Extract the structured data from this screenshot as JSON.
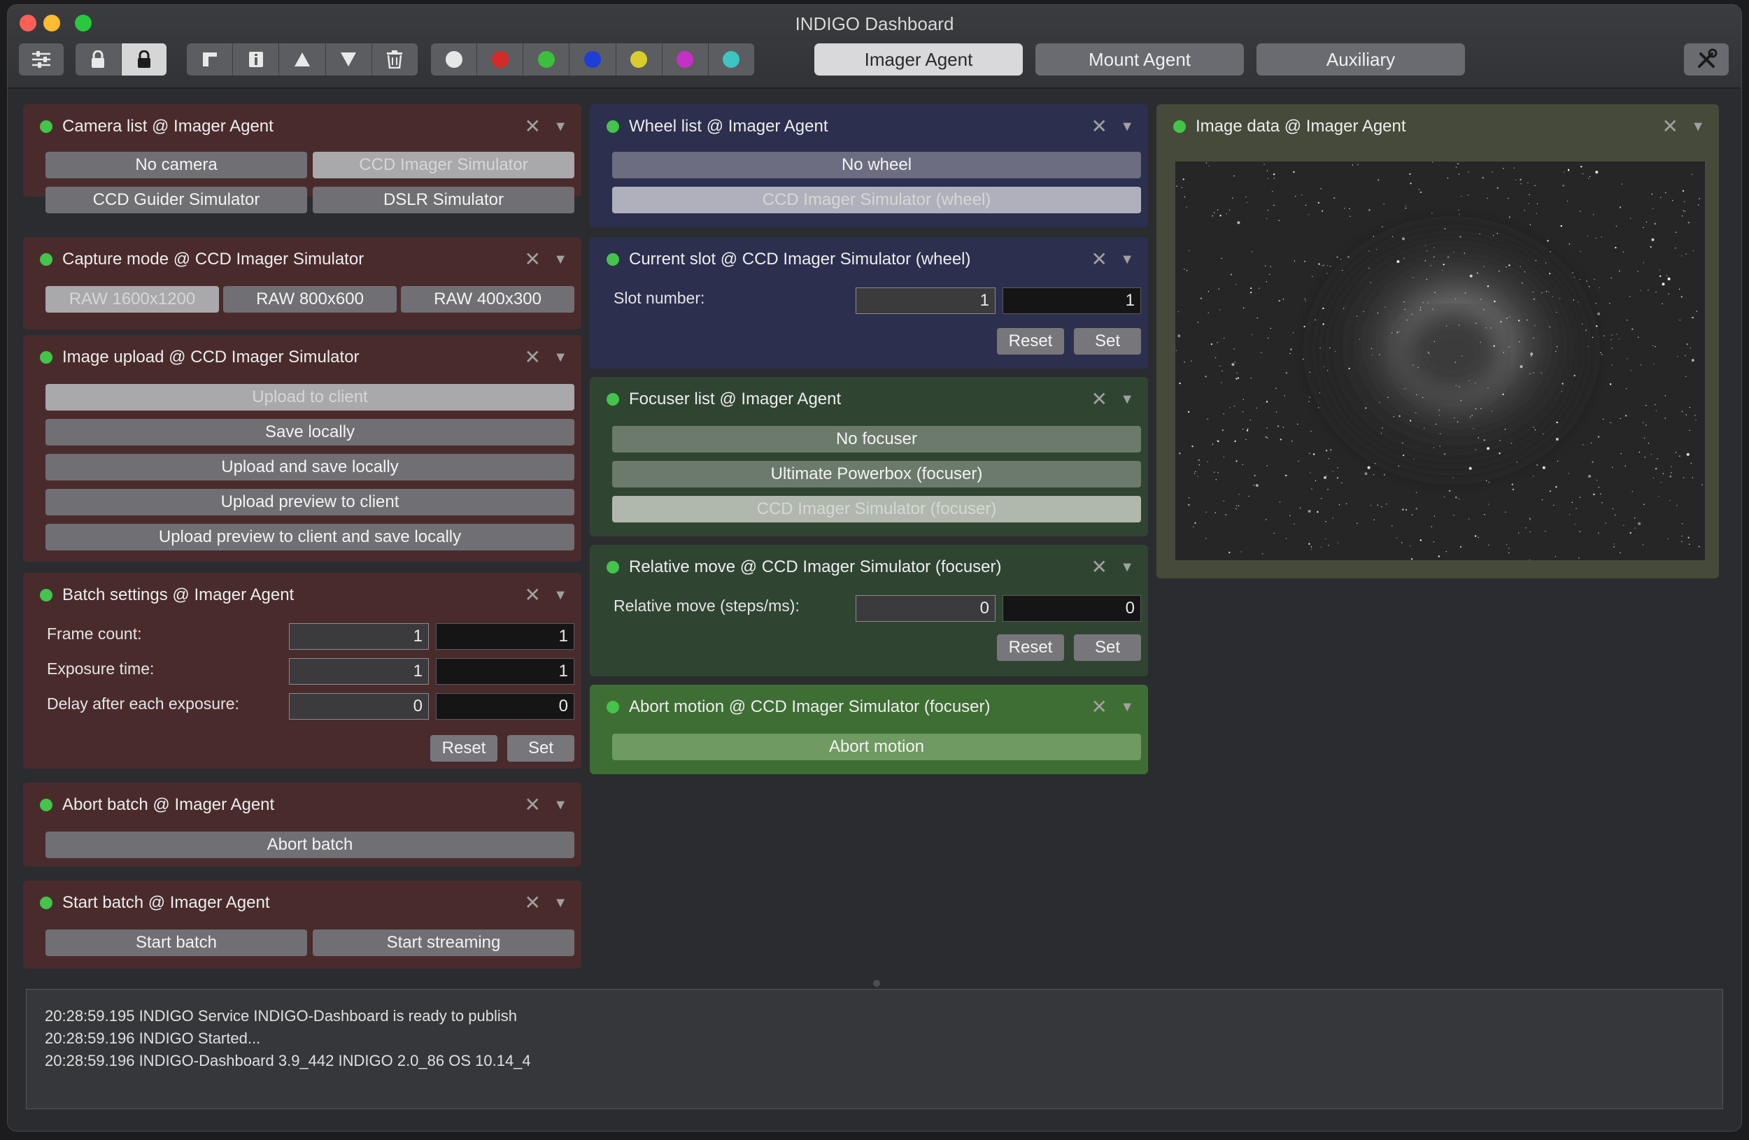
{
  "window": {
    "title": "INDIGO Dashboard"
  },
  "colors": {
    "close": "#fe5f57",
    "minimize": "#febc2e",
    "maximize": "#28c840",
    "panel_red": "#4a2b2c",
    "panel_blue": "#2d2f4f",
    "panel_green": "#2f4532",
    "panel_olive": "#464a3a",
    "led": "#43c44a"
  },
  "toolbar": {
    "icons": [
      "sliders-icon",
      "lock-open-icon",
      "lock-icon",
      "window-split-icon",
      "info-icon",
      "arrow-up-icon",
      "arrow-down-icon",
      "trash-icon"
    ],
    "color_dots": [
      "#e6e6e6",
      "#d42a2a",
      "#3cbf3c",
      "#1d3fd6",
      "#d8cc2e",
      "#c530c5",
      "#3fc4c4"
    ]
  },
  "tabs": [
    {
      "label": "Imager Agent",
      "active": true
    },
    {
      "label": "Mount Agent",
      "active": false
    },
    {
      "label": "Auxiliary",
      "active": false
    }
  ],
  "panels": {
    "camera_list": {
      "title": "Camera list @ Imager Agent",
      "items": [
        "No camera",
        "CCD Imager Simulator",
        "CCD Guider Simulator",
        "DSLR Simulator"
      ]
    },
    "capture_mode": {
      "title": "Capture mode @ CCD Imager Simulator",
      "items": [
        "RAW 1600x1200",
        "RAW 800x600",
        "RAW 400x300"
      ]
    },
    "image_upload": {
      "title": "Image upload @ CCD Imager Simulator",
      "items": [
        "Upload to client",
        "Save locally",
        "Upload and save locally",
        "Upload preview to client",
        "Upload preview to client and save locally"
      ]
    },
    "batch_settings": {
      "title": "Batch settings @ Imager Agent",
      "rows": [
        {
          "label": "Frame count:",
          "target": "1",
          "value": "1"
        },
        {
          "label": "Exposure time:",
          "target": "1",
          "value": "1"
        },
        {
          "label": "Delay after each exposure:",
          "target": "0",
          "value": "0"
        }
      ],
      "reset": "Reset",
      "set": "Set"
    },
    "abort_batch": {
      "title": "Abort batch @ Imager Agent",
      "button": "Abort batch"
    },
    "start_batch": {
      "title": "Start batch @ Imager Agent",
      "items": [
        "Start batch",
        "Start streaming"
      ]
    },
    "wheel_list": {
      "title": "Wheel list @ Imager Agent",
      "items": [
        "No wheel",
        "CCD Imager Simulator (wheel)"
      ]
    },
    "current_slot": {
      "title": "Current slot @ CCD Imager Simulator (wheel)",
      "label": "Slot number:",
      "target": "1",
      "value": "1",
      "reset": "Reset",
      "set": "Set"
    },
    "focuser_list": {
      "title": "Focuser list @ Imager Agent",
      "items": [
        "No focuser",
        "Ultimate Powerbox (focuser)",
        "CCD Imager Simulator (focuser)"
      ]
    },
    "relative_move": {
      "title": "Relative move @ CCD Imager Simulator (focuser)",
      "label": "Relative move (steps/ms):",
      "target": "0",
      "value": "0",
      "reset": "Reset",
      "set": "Set"
    },
    "abort_motion": {
      "title": "Abort motion @ CCD Imager Simulator (focuser)",
      "button": "Abort motion"
    },
    "image_data": {
      "title": "Image data @ Imager Agent"
    }
  },
  "log": [
    "20:28:59.195 INDIGO Service INDIGO-Dashboard is ready to publish",
    "20:28:59.196 INDIGO Started...",
    "20:28:59.196 INDIGO-Dashboard 3.9_442 INDIGO 2.0_86 OS 10.14_4"
  ]
}
